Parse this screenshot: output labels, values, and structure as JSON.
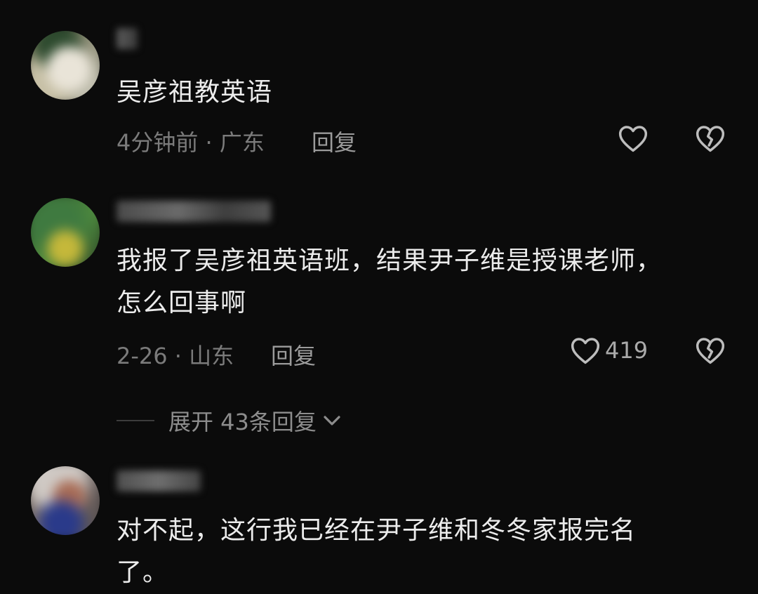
{
  "comments": [
    {
      "username": "",
      "text": "吴彦祖教英语",
      "meta": "4分钟前 · 广东",
      "reply_label": "回复",
      "likes": "",
      "like_icon": "heart-icon",
      "dislike_icon": "broken-heart-icon"
    },
    {
      "username": "",
      "text": "我报了吴彦祖英语班，结果尹子维是授课老师，\n怎么回事啊",
      "meta": "2-26 · 山东",
      "reply_label": "回复",
      "likes": "419",
      "like_icon": "heart-icon",
      "dislike_icon": "broken-heart-icon",
      "expand_label": "展开 43条回复"
    },
    {
      "username": "",
      "text": "对不起，这行我已经在尹子维和冬冬家报完名\n了。",
      "meta": "",
      "reply_label": "",
      "likes": ""
    }
  ],
  "colors": {
    "background": "#0b0b0b",
    "text": "#ececec",
    "meta": "#7b7b7b",
    "icon": "#bdbdbd"
  }
}
